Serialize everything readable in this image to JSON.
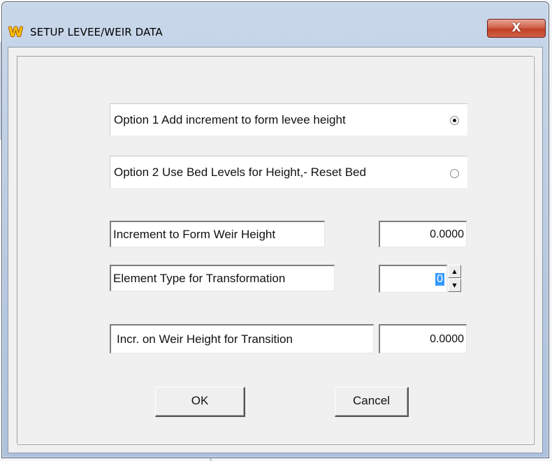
{
  "window": {
    "title": "SETUP LEVEE/WEIR DATA",
    "app_icon": "W",
    "close_label": "X"
  },
  "options": [
    {
      "label": "Option 1  Add increment to form levee height",
      "selected": true
    },
    {
      "label": "Option 2  Use  Bed Levels for Height,-  Reset Bed",
      "selected": false
    }
  ],
  "fields": {
    "increment": {
      "label": "Increment to Form Weir Height",
      "value": "0.0000"
    },
    "element_type": {
      "label": "Element Type for Transformation",
      "value": "0"
    },
    "transition": {
      "label": "Incr. on Weir Height  for Transition",
      "value": "0.0000"
    }
  },
  "buttons": {
    "ok": "OK",
    "cancel": "Cancel"
  },
  "colors": {
    "close_button": "#c24128",
    "selection": "#3399ff",
    "client_bg": "#f0f0f0"
  }
}
